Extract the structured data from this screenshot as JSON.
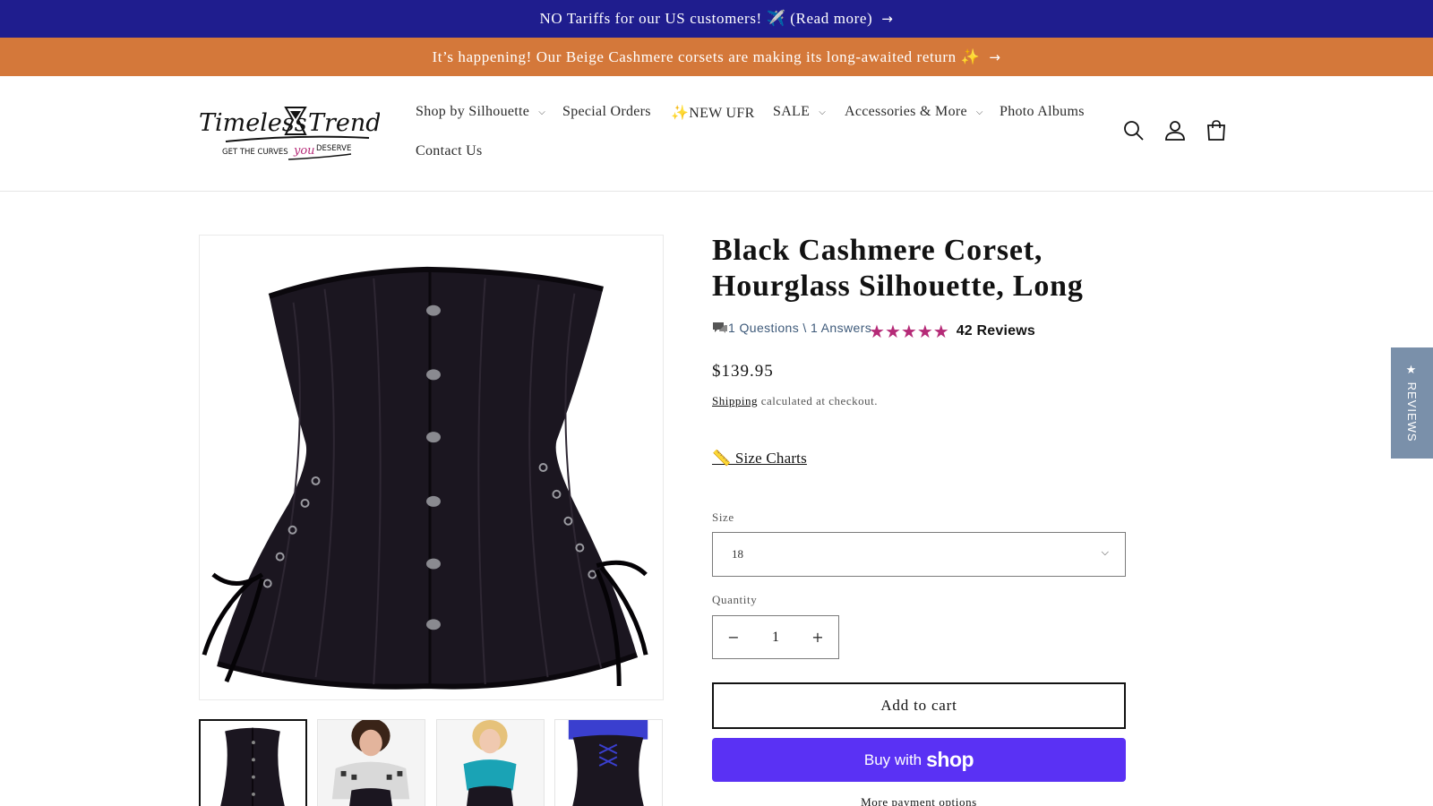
{
  "announcements": [
    {
      "text": "NO Tariffs for our US customers! ✈️ (Read more)",
      "arrow": "→"
    },
    {
      "text": "It’s happening! Our Beige Cashmere corsets are making its long-awaited return ✨",
      "arrow": "→"
    }
  ],
  "header": {
    "logo": {
      "brand": "Timeless Trends",
      "tagline_before": "GET THE CURVES",
      "tagline_emph": "you",
      "tagline_after": "DESERVE"
    },
    "nav": [
      {
        "label": "Shop by Silhouette",
        "dropdown": true
      },
      {
        "label": "Special Orders",
        "dropdown": false
      },
      {
        "label": "✨NEW UFR",
        "dropdown": false
      },
      {
        "label": "SALE",
        "dropdown": true
      },
      {
        "label": "Accessories & More",
        "dropdown": true
      },
      {
        "label": "Photo Albums",
        "dropdown": false
      },
      {
        "label": "Contact Us",
        "dropdown": false
      }
    ],
    "icons": [
      "search-icon",
      "account-icon",
      "cart-icon"
    ]
  },
  "product": {
    "title": "Black Cashmere Corset, Hourglass Silhouette, Long",
    "qa_text": "1 Questions \\ 1 Answers",
    "rating": 5,
    "reviews_text": "42 Reviews",
    "price": "$139.95",
    "shipping_link": "Shipping",
    "shipping_rest": " calculated at checkout.",
    "size_charts": "📏 Size Charts",
    "size_label": "Size",
    "size_value": "18",
    "quantity_label": "Quantity",
    "quantity_value": "1",
    "add_to_cart": "Add to cart",
    "buy_with": "Buy with",
    "buy_brand": "shop",
    "more_payment": "More payment options"
  },
  "reviews_tab": "★ REVIEWS",
  "colors": {
    "announcement1_bg": "#1f1d8e",
    "announcement2_bg": "#d4783a",
    "star": "#b52a77",
    "shop_pay": "#5a31f4",
    "reviews_tab": "#7a90aa"
  }
}
